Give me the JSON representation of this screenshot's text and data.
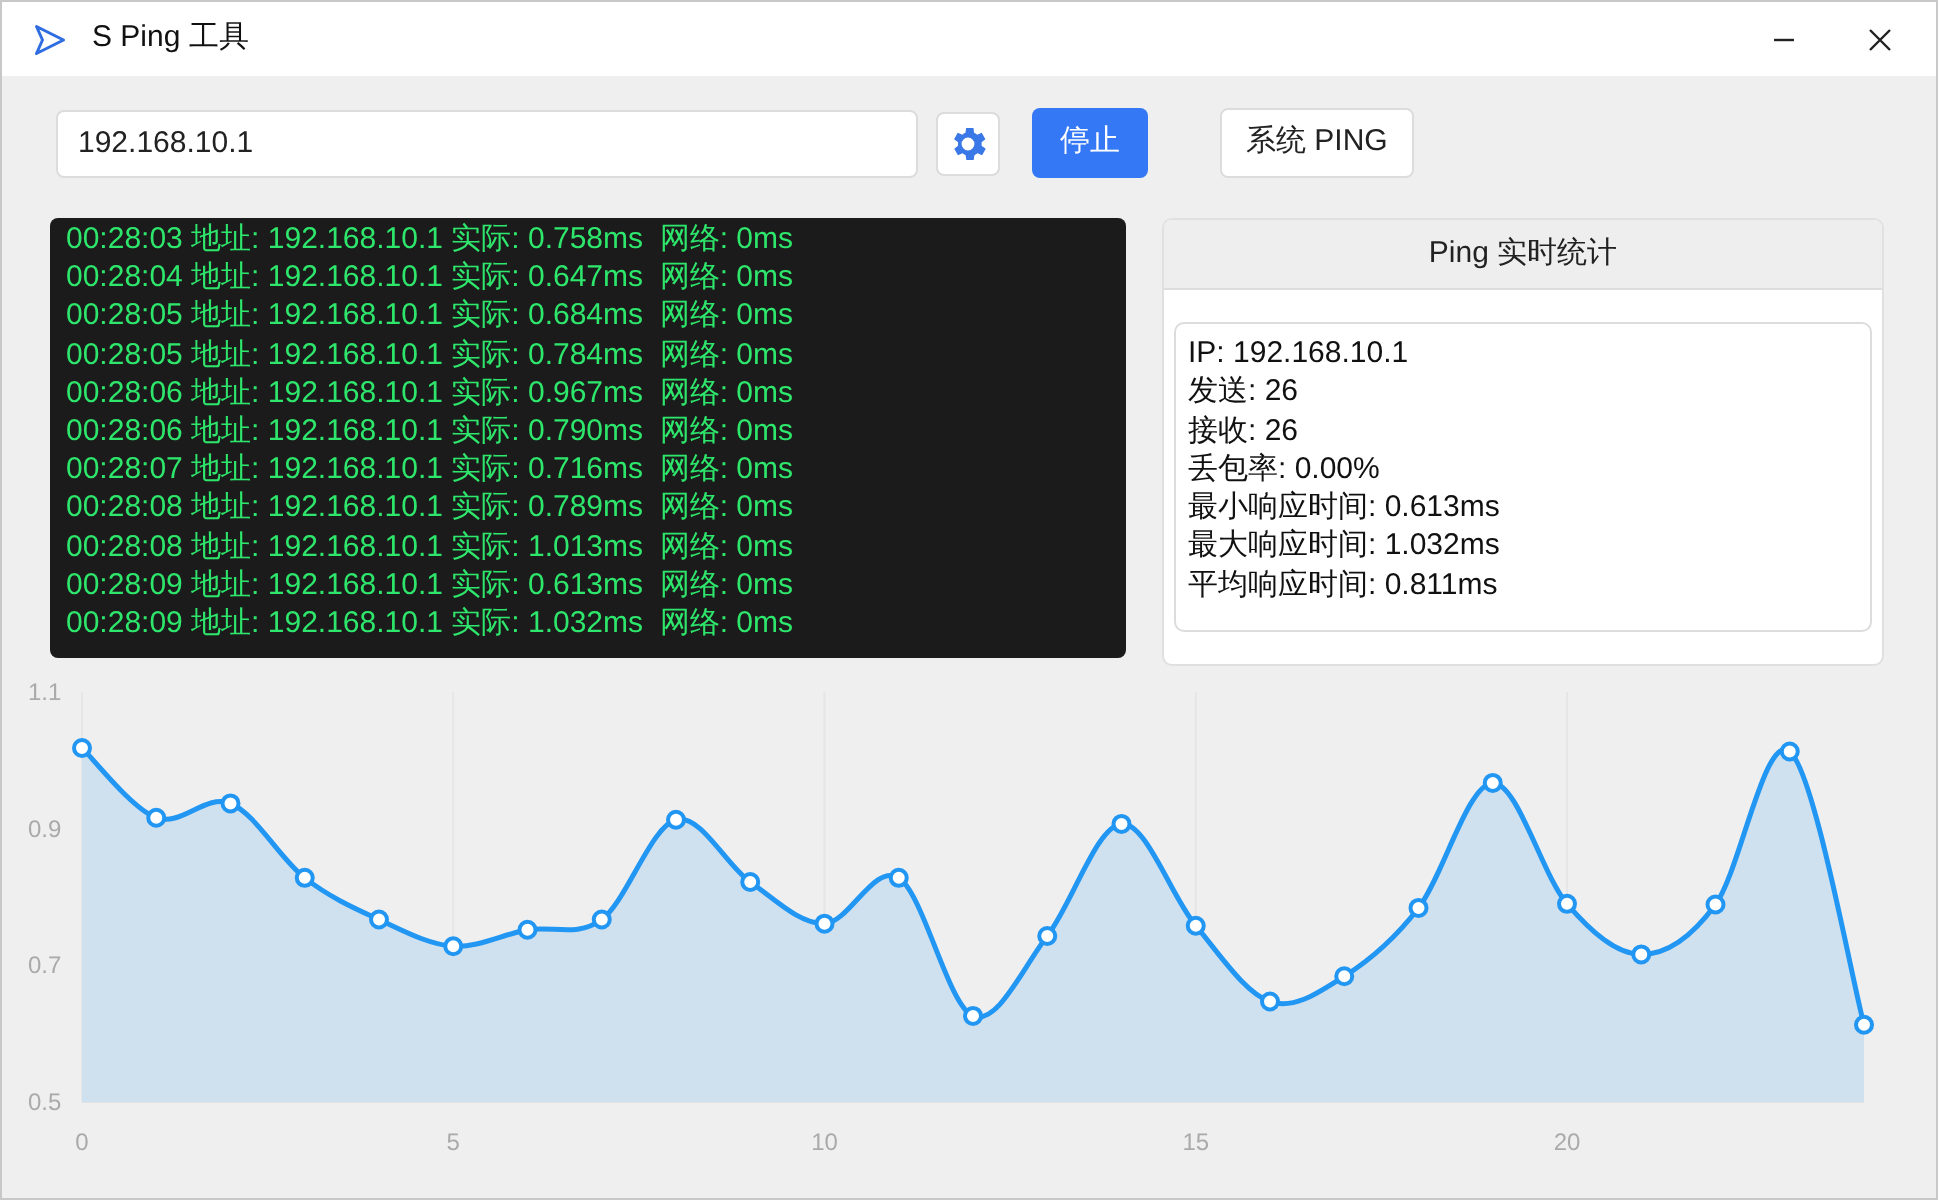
{
  "window": {
    "title": "S Ping 工具"
  },
  "toolbar": {
    "address": "192.168.10.1",
    "stop_button": "停止",
    "system_ping_button": "系统 PING"
  },
  "console": {
    "lines": [
      "00:28:03 地址: 192.168.10.1 实际: 0.758ms  网络: 0ms",
      "00:28:04 地址: 192.168.10.1 实际: 0.647ms  网络: 0ms",
      "00:28:05 地址: 192.168.10.1 实际: 0.684ms  网络: 0ms",
      "00:28:05 地址: 192.168.10.1 实际: 0.784ms  网络: 0ms",
      "00:28:06 地址: 192.168.10.1 实际: 0.967ms  网络: 0ms",
      "00:28:06 地址: 192.168.10.1 实际: 0.790ms  网络: 0ms",
      "00:28:07 地址: 192.168.10.1 实际: 0.716ms  网络: 0ms",
      "00:28:08 地址: 192.168.10.1 实际: 0.789ms  网络: 0ms",
      "00:28:08 地址: 192.168.10.1 实际: 1.013ms  网络: 0ms",
      "00:28:09 地址: 192.168.10.1 实际: 0.613ms  网络: 0ms",
      "00:28:09 地址: 192.168.10.1 实际: 1.032ms  网络: 0ms"
    ]
  },
  "stats": {
    "title": "Ping 实时统计",
    "lines": [
      "IP: 192.168.10.1",
      "发送: 26",
      "接收: 26",
      "丢包率: 0.00%",
      "最小响应时间: 0.613ms",
      "最大响应时间: 1.032ms",
      "平均响应时间: 0.811ms"
    ]
  },
  "chart": {
    "chart_data": {
      "type": "area",
      "x": [
        0,
        1,
        2,
        3,
        4,
        5,
        6,
        7,
        8,
        9,
        10,
        11,
        12,
        13,
        14,
        15,
        16,
        17,
        18,
        19,
        20,
        21,
        22,
        23,
        24
      ],
      "series": [
        {
          "color": "#2196f3",
          "values": [
            1.018,
            0.916,
            0.937,
            0.828,
            0.767,
            0.728,
            0.752,
            0.767,
            0.913,
            0.822,
            0.761,
            0.828,
            0.626,
            0.743,
            0.907,
            0.758,
            0.647,
            0.684,
            0.784,
            0.967,
            0.79,
            0.716,
            0.789,
            1.013,
            0.613
          ]
        }
      ],
      "xlim": [
        0,
        24
      ],
      "grid": true,
      "ylim": [
        0.5,
        1.1
      ],
      "xticks": [
        0,
        5,
        10,
        15,
        20
      ],
      "yticks": [
        0.5,
        0.7,
        0.9,
        1.1
      ]
    }
  }
}
